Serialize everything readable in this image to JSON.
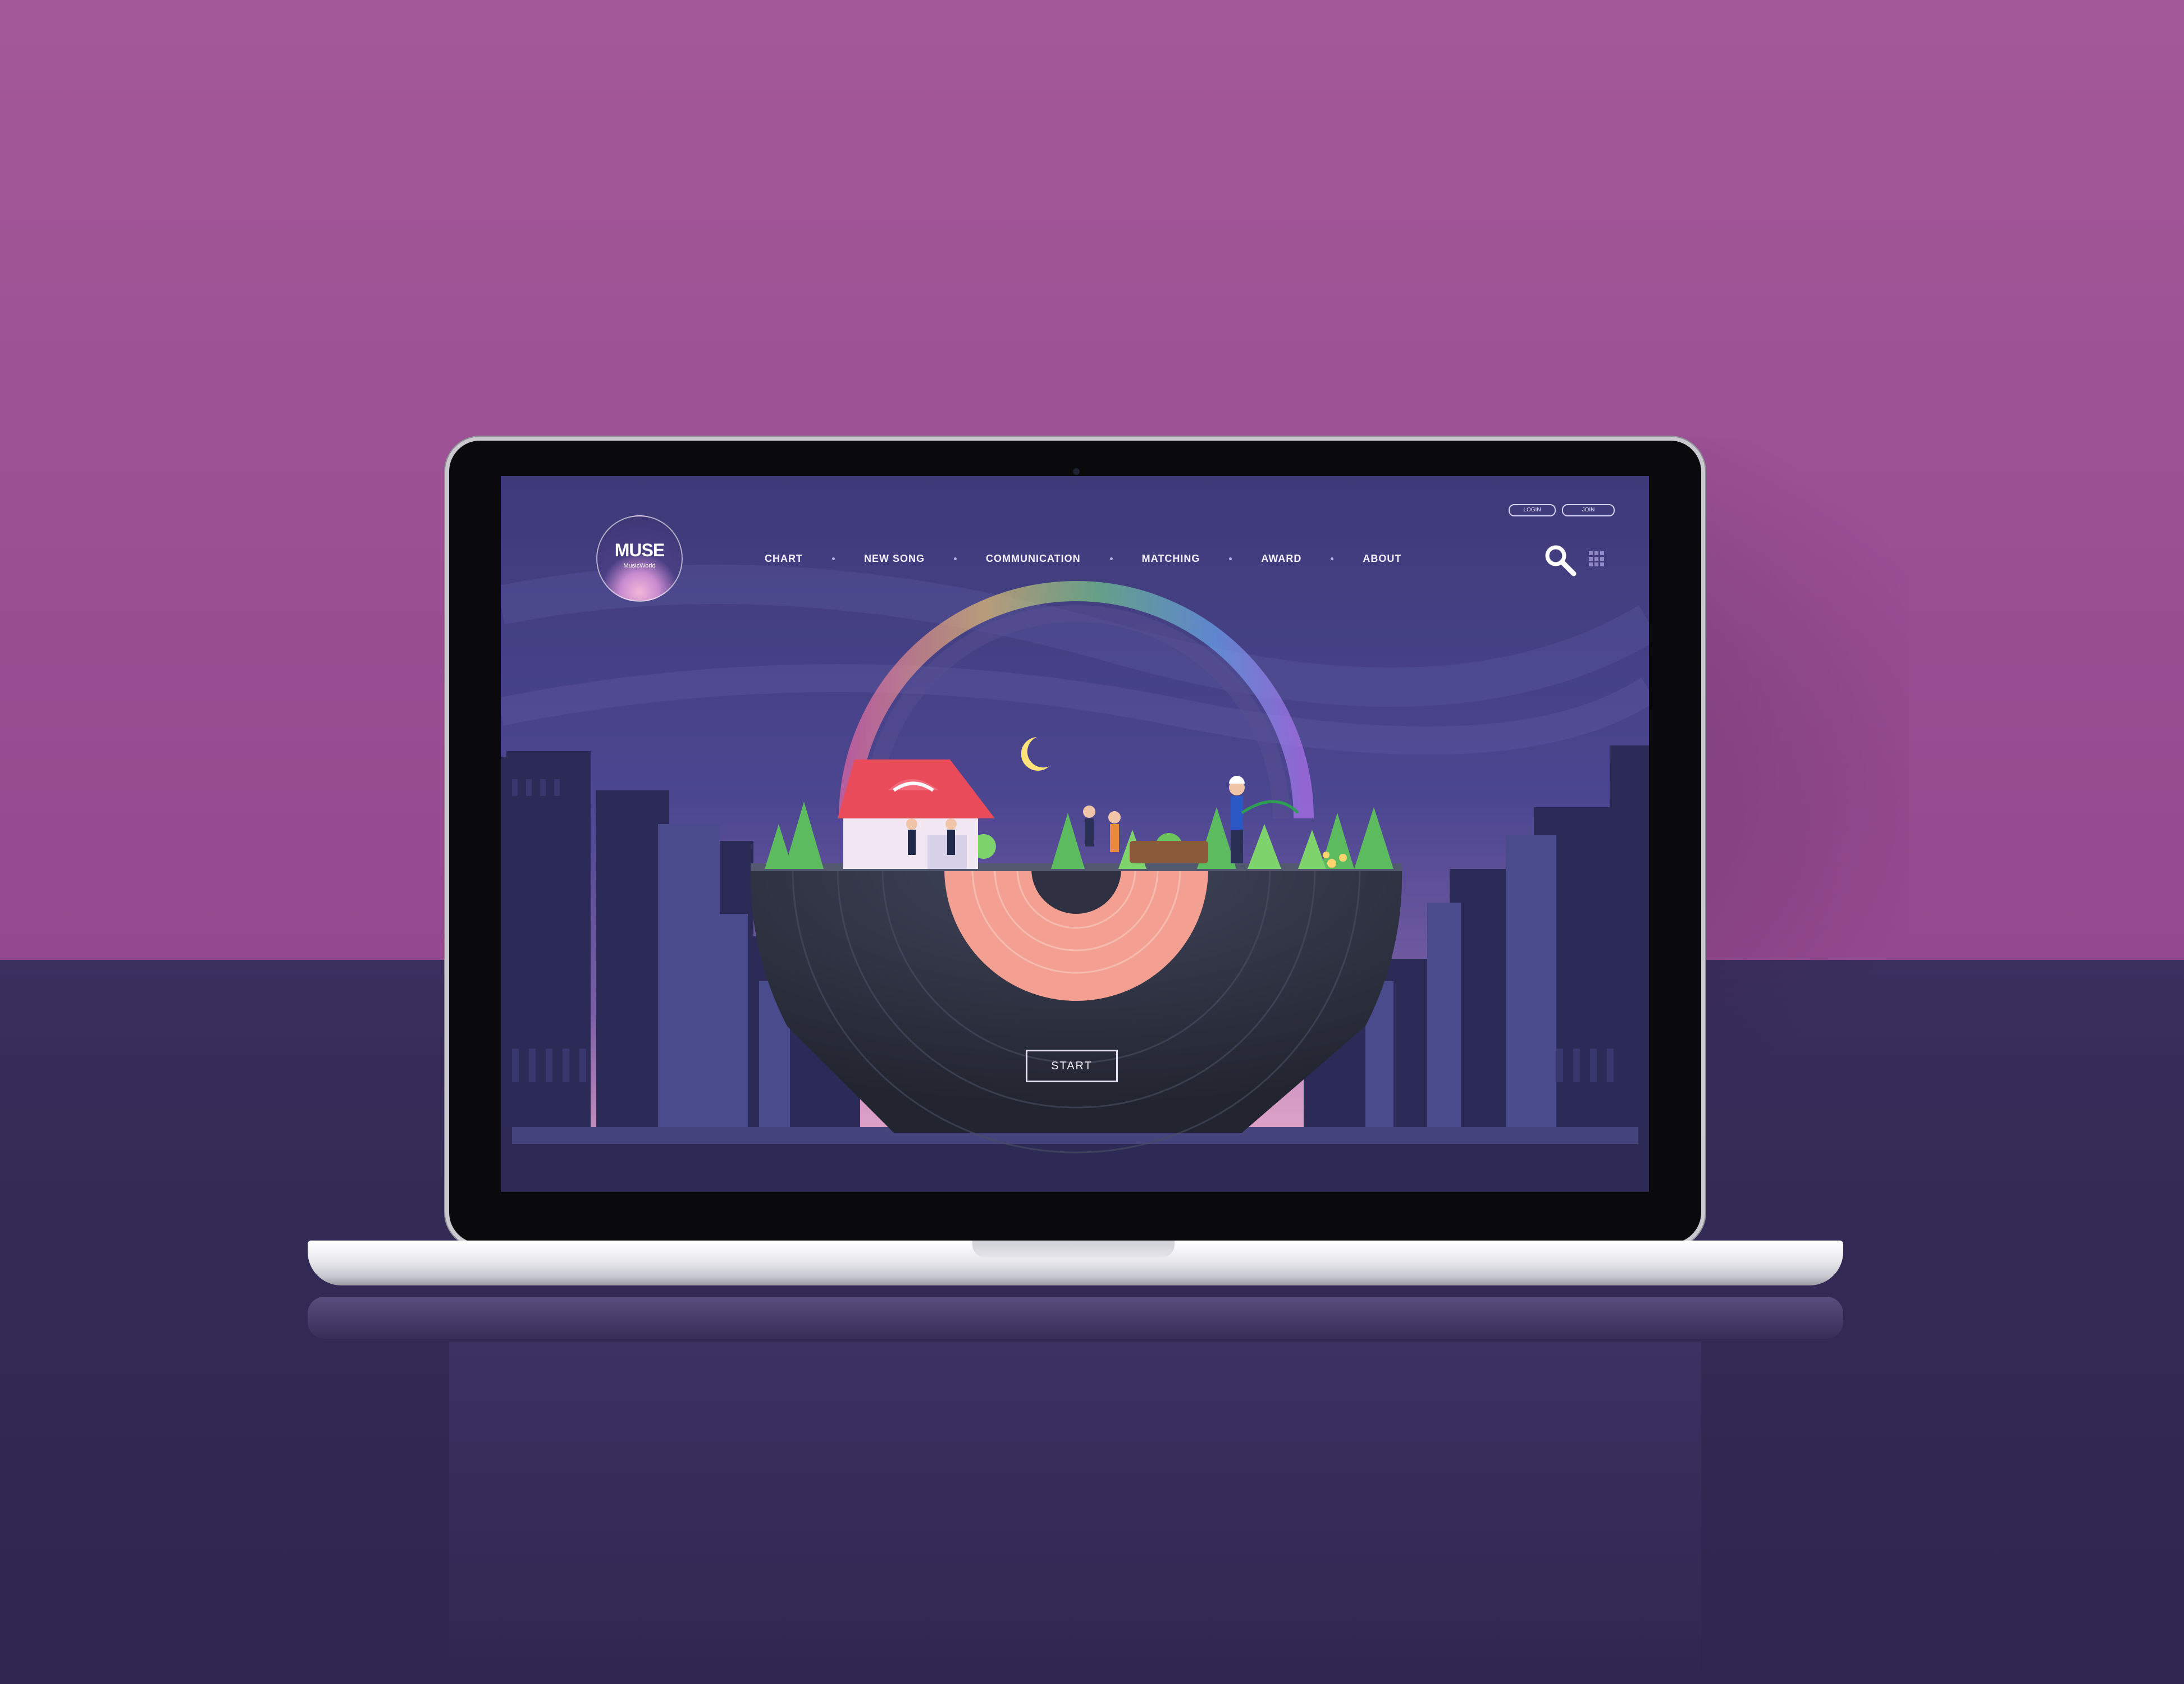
{
  "site": {
    "logo_title": "MUSE",
    "logo_subtitle": "MusicWorld",
    "nav": [
      "CHART",
      "NEW SONG",
      "COMMUNICATION",
      "MATCHING",
      "AWARD",
      "ABOUT"
    ],
    "top_buttons": {
      "login": "LOGIN",
      "join": "JOIN"
    },
    "start_label": "START",
    "icons": {
      "search": "search-icon",
      "menu": "grid-menu-icon"
    }
  },
  "colors": {
    "wall": "#9f5596",
    "desk": "#31284f",
    "sky_top": "#3e3a78",
    "sky_glow": "#e8a6c8",
    "vinyl_label": "#f3a093",
    "vinyl": "#2c2f3e"
  }
}
